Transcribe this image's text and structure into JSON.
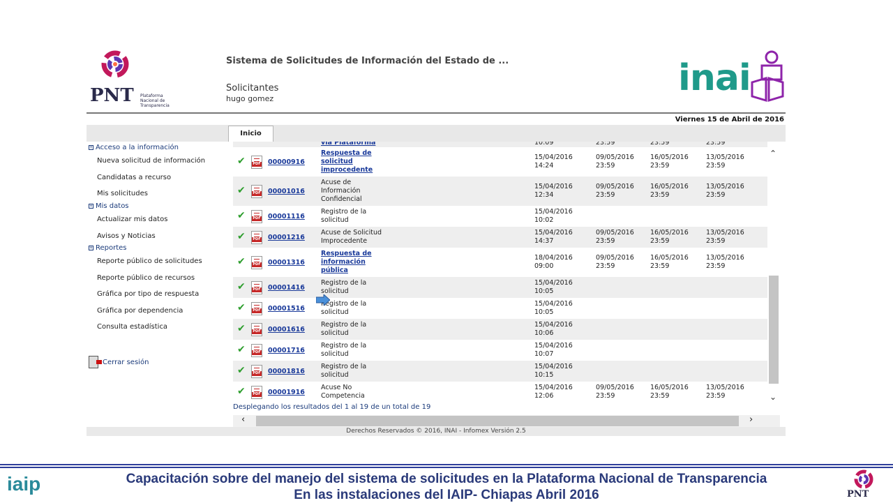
{
  "header": {
    "system_title": "Sistema de Solicitudes de Información del Estado de ...",
    "role": "Solicitantes",
    "user": "hugo gomez",
    "date": "Viernes 15 de Abril de 2016",
    "pnt_logo_text": "PNT",
    "pnt_logo_sub": "Plataforma Nacional de Transparencia",
    "inai_logo_text": "inai"
  },
  "tabs": [
    {
      "label": "Inicio"
    }
  ],
  "sidebar": {
    "sections": [
      {
        "label": "Acceso a la información",
        "items": [
          "Nueva solicitud de información",
          "Candidatas a recurso",
          "Mis solicitudes"
        ]
      },
      {
        "label": "Mis datos",
        "items": [
          "Actualizar mis datos",
          "Avisos y Noticias"
        ]
      },
      {
        "label": "Reportes",
        "items": [
          "Reporte público de solicitudes",
          "Reporte público de recursos",
          "Gráfica por tipo de respuesta",
          "Gráfica por dependencia",
          "Consulta estadística"
        ]
      }
    ],
    "logout": "Cerrar sesión"
  },
  "table": {
    "partial_row": {
      "desc": "vía Plataforma",
      "d1": "10:09",
      "d2": "23:59",
      "d3": "23:59",
      "d4": "23:59"
    },
    "rows": [
      {
        "folio": "00000916",
        "desc": [
          "Respuesta de",
          "solicitud",
          "improcedente"
        ],
        "desc_link": true,
        "d1": [
          "15/04/2016",
          "14:24"
        ],
        "d2": [
          "09/05/2016",
          "23:59"
        ],
        "d3": [
          "16/05/2016",
          "23:59"
        ],
        "d4": [
          "13/05/2016",
          "23:59"
        ]
      },
      {
        "folio": "00001016",
        "desc": [
          "Acuse de",
          "Información",
          "Confidencial"
        ],
        "desc_link": false,
        "d1": [
          "15/04/2016",
          "12:34"
        ],
        "d2": [
          "09/05/2016",
          "23:59"
        ],
        "d3": [
          "16/05/2016",
          "23:59"
        ],
        "d4": [
          "13/05/2016",
          "23:59"
        ]
      },
      {
        "folio": "00001116",
        "desc": [
          "Registro de la",
          "solicitud"
        ],
        "desc_link": false,
        "d1": [
          "15/04/2016",
          "10:02"
        ],
        "d2": [],
        "d3": [],
        "d4": []
      },
      {
        "folio": "00001216",
        "desc": [
          "Acuse de Solicitud",
          "Improcedente"
        ],
        "desc_link": false,
        "d1": [
          "15/04/2016",
          "14:37"
        ],
        "d2": [
          "09/05/2016",
          "23:59"
        ],
        "d3": [
          "16/05/2016",
          "23:59"
        ],
        "d4": [
          "13/05/2016",
          "23:59"
        ]
      },
      {
        "folio": "00001316",
        "desc": [
          "Respuesta de",
          "información",
          "pública"
        ],
        "desc_link": true,
        "d1": [
          "18/04/2016",
          "09:00"
        ],
        "d2": [
          "09/05/2016",
          "23:59"
        ],
        "d3": [
          "16/05/2016",
          "23:59"
        ],
        "d4": [
          "13/05/2016",
          "23:59"
        ]
      },
      {
        "folio": "00001416",
        "desc": [
          "Registro de la",
          "solicitud"
        ],
        "desc_link": false,
        "d1": [
          "15/04/2016",
          "10:05"
        ],
        "d2": [],
        "d3": [],
        "d4": []
      },
      {
        "folio": "00001516",
        "desc": [
          "Registro de la",
          "solicitud"
        ],
        "desc_link": false,
        "d1": [
          "15/04/2016",
          "10:05"
        ],
        "d2": [],
        "d3": [],
        "d4": []
      },
      {
        "folio": "00001616",
        "desc": [
          "Registro de la",
          "solicitud"
        ],
        "desc_link": false,
        "d1": [
          "15/04/2016",
          "10:06"
        ],
        "d2": [],
        "d3": [],
        "d4": []
      },
      {
        "folio": "00001716",
        "desc": [
          "Registro de la",
          "solicitud"
        ],
        "desc_link": false,
        "d1": [
          "15/04/2016",
          "10:07"
        ],
        "d2": [],
        "d3": [],
        "d4": []
      },
      {
        "folio": "00001816",
        "desc": [
          "Registro de la",
          "solicitud"
        ],
        "desc_link": false,
        "d1": [
          "15/04/2016",
          "10:15"
        ],
        "d2": [],
        "d3": [],
        "d4": []
      },
      {
        "folio": "00001916",
        "desc": [
          "Acuse No",
          "Competencia"
        ],
        "desc_link": false,
        "d1": [
          "15/04/2016",
          "12:06"
        ],
        "d2": [
          "09/05/2016",
          "23:59"
        ],
        "d3": [
          "16/05/2016",
          "23:59"
        ],
        "d4": [
          "13/05/2016",
          "23:59"
        ]
      }
    ],
    "results_text": "Desplegando los resultados del 1 al 19 de un total de 19"
  },
  "copyright": "Derechos Reservados © 2016, INAI - Infomex Versión 2.5",
  "slide_footer": {
    "line1": "Capacitación sobre del manejo del sistema de solicitudes en la Plataforma Nacional de Transparencia",
    "line2": "En las instalaciones del IAIP- Chiapas    Abril 2016",
    "iaip_logo_text": "iaip",
    "pnt_logo_text": "PNT"
  },
  "colors": {
    "link": "#1a3a9a",
    "check": "#2e9e2e",
    "pdf_red": "#c62828",
    "inai_teal": "#1f9a8a",
    "footer_blue": "#2a3a7a"
  }
}
